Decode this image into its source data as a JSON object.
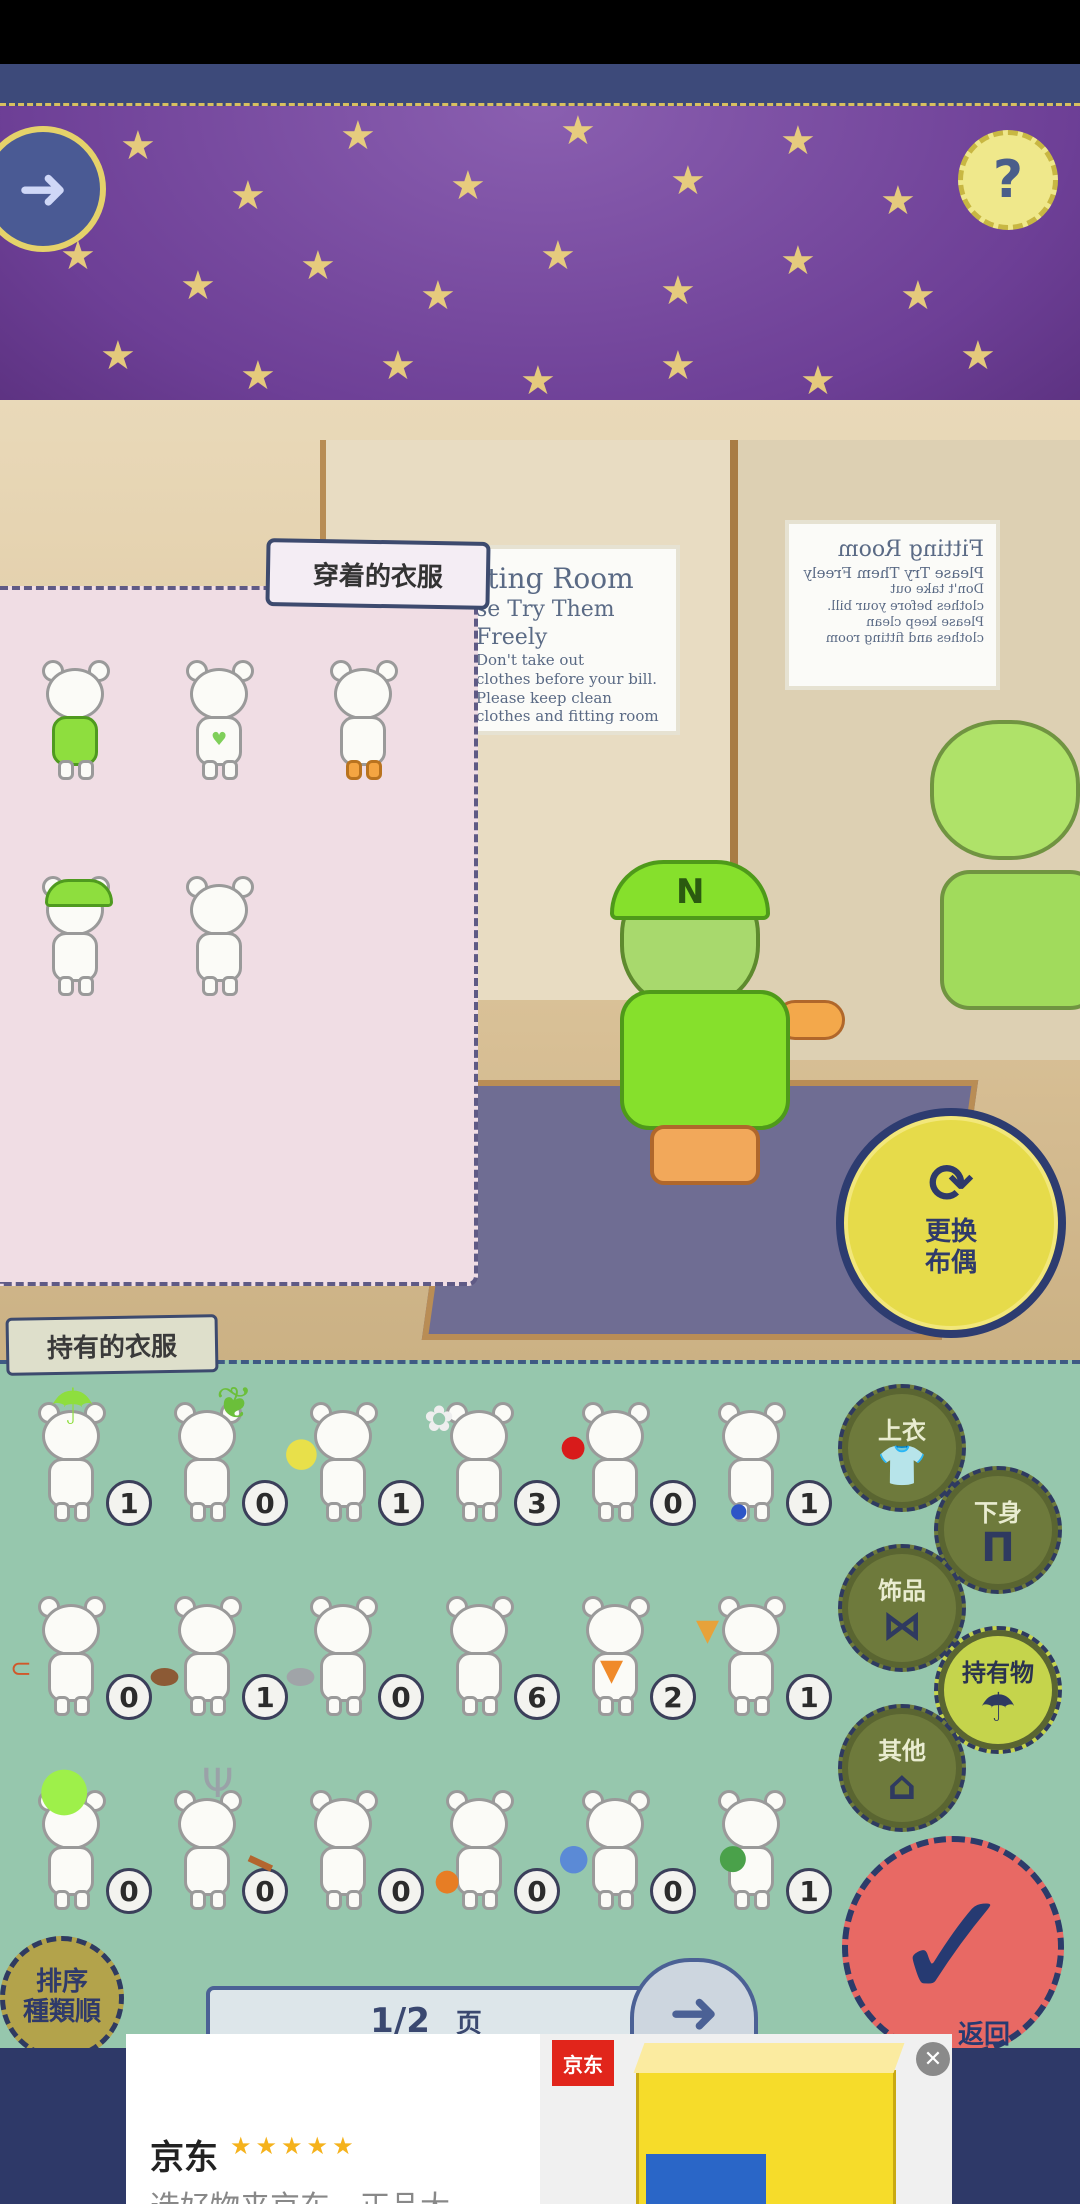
{
  "panels": {
    "wearing_title": "穿着的衣服",
    "owned_title": "持有的衣服"
  },
  "signs": {
    "sign1": [
      "tting Room",
      "se Try Them Freely",
      "Don't take out",
      "clothes before your bill.",
      "Please keep clean",
      "clothes and fitting room"
    ],
    "sign2": [
      "Fitting Room",
      "Please Try Them Freely",
      "Don't take out",
      "clothes before your bill.",
      "Please keep clean",
      "clothes and fitting room"
    ]
  },
  "buttons": {
    "change_doll": "更换布偶",
    "sort": "排序",
    "sort2": "種類順",
    "confirm": "返回"
  },
  "categories": [
    {
      "label": "上衣",
      "icon": "shirt-icon"
    },
    {
      "label": "下身",
      "icon": "pants-icon"
    },
    {
      "label": "饰品",
      "icon": "hat-bow-icon"
    },
    {
      "label": "持有物",
      "icon": "umbrella-icon"
    },
    {
      "label": "其他",
      "icon": "bag-icon"
    }
  ],
  "owned_counts": [
    [
      "1",
      "0",
      "1",
      "3",
      "0",
      "1"
    ],
    [
      "0",
      "1",
      "0",
      "6",
      "2",
      "1"
    ],
    [
      "0",
      "0",
      "0",
      "0",
      "0",
      "1"
    ]
  ],
  "pager": {
    "current": "1/2",
    "unit": "页"
  },
  "ad": {
    "logo": "京东",
    "title": "京东",
    "stars": "★★★★★",
    "subtitle": "选好物来京东，正品大",
    "close": "✕"
  }
}
